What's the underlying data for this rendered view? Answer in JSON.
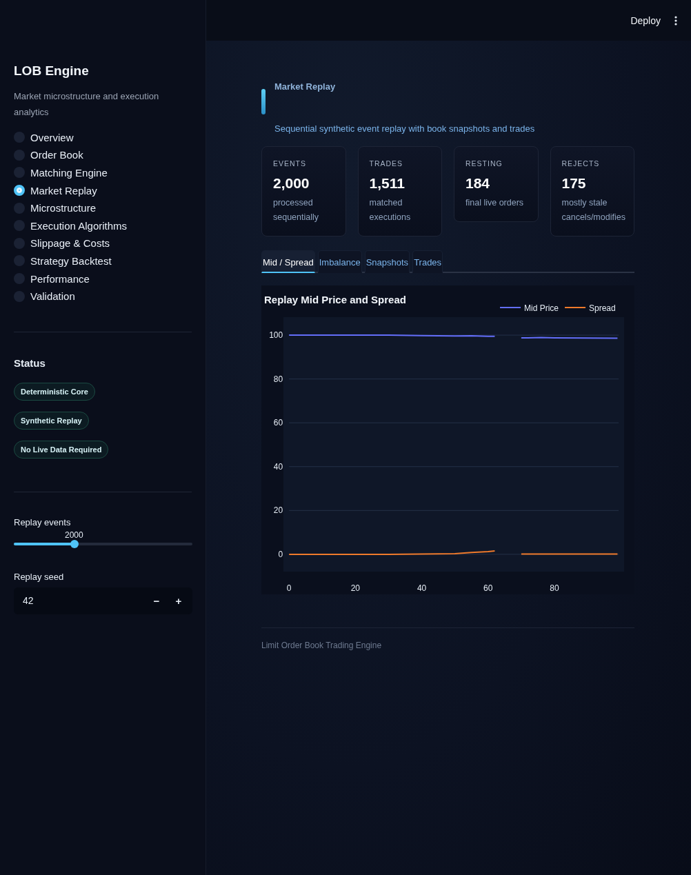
{
  "header": {
    "deploy": "Deploy"
  },
  "sidebar": {
    "title": "LOB Engine",
    "subtitle": "Market microstructure and execution analytics",
    "nav": [
      {
        "label": "Overview",
        "selected": false
      },
      {
        "label": "Order Book",
        "selected": false
      },
      {
        "label": "Matching Engine",
        "selected": false
      },
      {
        "label": "Market Replay",
        "selected": true
      },
      {
        "label": "Microstructure",
        "selected": false
      },
      {
        "label": "Execution Algorithms",
        "selected": false
      },
      {
        "label": "Slippage & Costs",
        "selected": false
      },
      {
        "label": "Strategy Backtest",
        "selected": false
      },
      {
        "label": "Performance",
        "selected": false
      },
      {
        "label": "Validation",
        "selected": false
      }
    ],
    "status": {
      "heading": "Status",
      "badges": [
        "Deterministic Core",
        "Synthetic Replay",
        "No Live Data Required"
      ]
    },
    "replay_events": {
      "label": "Replay events",
      "value": "2000",
      "level": 0.34
    },
    "replay_seed": {
      "label": "Replay seed",
      "value": "42",
      "decrement": "−",
      "increment": "+"
    }
  },
  "page": {
    "title": "Market Replay",
    "subtitle": "Sequential synthetic event replay with book snapshots and trades",
    "metrics": [
      {
        "label": "EVENTS",
        "value": "2,000",
        "note": "processed sequentially"
      },
      {
        "label": "TRADES",
        "value": "1,511",
        "note": "matched executions"
      },
      {
        "label": "RESTING",
        "value": "184",
        "note": "final live orders"
      },
      {
        "label": "REJECTS",
        "value": "175",
        "note": "mostly stale cancels/modifies"
      }
    ],
    "tabs": [
      {
        "label": "Mid / Spread",
        "selected": true
      },
      {
        "label": "Imbalance",
        "selected": false
      },
      {
        "label": "Snapshots",
        "selected": false
      },
      {
        "label": "Trades",
        "selected": false
      }
    ],
    "chart": {
      "chart_data": {
        "type": "line",
        "title": "Replay Mid Price and Spread",
        "x": [
          0,
          10,
          20,
          30,
          40,
          50,
          55,
          60,
          62,
          65,
          70,
          72,
          76,
          80,
          90,
          99
        ],
        "series": [
          {
            "name": "Mid Price",
            "color": "#636efa",
            "values": [
              100,
              100,
              100,
              100,
              99.8,
              99.6,
              99.7,
              99.5,
              99.5,
              null,
              98.8,
              98.8,
              98.9,
              98.8,
              98.7,
              98.6
            ]
          },
          {
            "name": "Spread",
            "color": "#ef7a2b",
            "values": [
              0,
              0,
              0,
              0,
              0.1,
              0.3,
              0.8,
              1.2,
              1.5,
              null,
              0.1,
              0.1,
              0.1,
              0.1,
              0.1,
              0.1
            ]
          }
        ],
        "xlim": [
          -1.7,
          101
        ],
        "ylim": [
          -7.9,
          108.2
        ],
        "grid": true,
        "legend": true,
        "xticks": [
          0,
          20,
          40,
          60,
          80
        ],
        "yticks": [
          0,
          20,
          40,
          60,
          80,
          100
        ]
      }
    },
    "footer": "Limit Order Book Trading Engine"
  }
}
